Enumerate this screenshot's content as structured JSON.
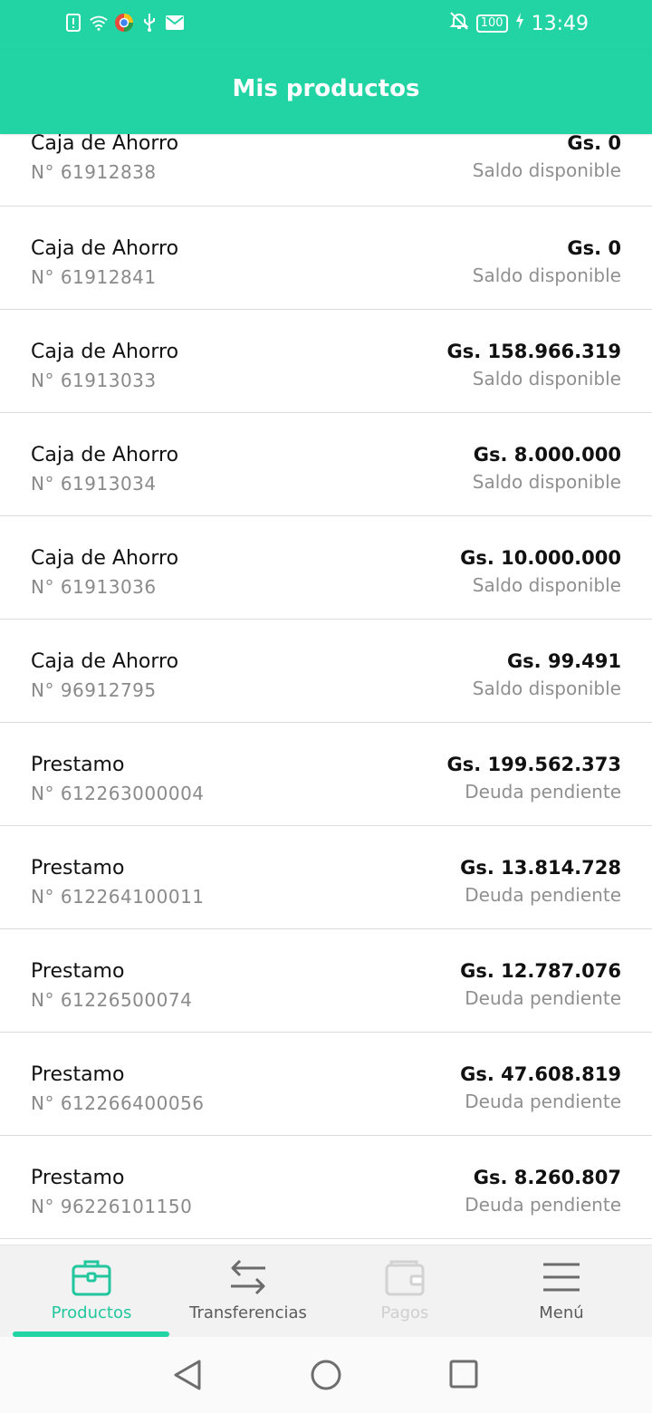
{
  "status": {
    "time": "13:49",
    "battery": "100",
    "icons": [
      "sim-alert-icon",
      "wifi-icon",
      "browser-icon",
      "usb-icon",
      "mail-icon",
      "notifications-off-icon",
      "charging-icon"
    ]
  },
  "header": {
    "title": "Mis productos"
  },
  "products": [
    {
      "name": "Caja de Ahorro",
      "number": "N° 61912838",
      "amount": "Gs. 0",
      "label": "Saldo disponible"
    },
    {
      "name": "Caja de Ahorro",
      "number": "N° 61912841",
      "amount": "Gs. 0",
      "label": "Saldo disponible"
    },
    {
      "name": "Caja de Ahorro",
      "number": "N° 61913033",
      "amount": "Gs. 158.966.319",
      "label": "Saldo disponible"
    },
    {
      "name": "Caja de Ahorro",
      "number": "N° 61913034",
      "amount": "Gs. 8.000.000",
      "label": "Saldo disponible"
    },
    {
      "name": "Caja de Ahorro",
      "number": "N° 61913036",
      "amount": "Gs. 10.000.000",
      "label": "Saldo disponible"
    },
    {
      "name": "Caja de Ahorro",
      "number": "N° 96912795",
      "amount": "Gs. 99.491",
      "label": "Saldo disponible"
    },
    {
      "name": "Prestamo",
      "number": "N° 612263000004",
      "amount": "Gs. 199.562.373",
      "label": "Deuda pendiente"
    },
    {
      "name": "Prestamo",
      "number": "N° 612264100011",
      "amount": "Gs. 13.814.728",
      "label": "Deuda pendiente"
    },
    {
      "name": "Prestamo",
      "number": "N° 61226500074",
      "amount": "Gs. 12.787.076",
      "label": "Deuda pendiente"
    },
    {
      "name": "Prestamo",
      "number": "N° 612266400056",
      "amount": "Gs. 47.608.819",
      "label": "Deuda pendiente"
    },
    {
      "name": "Prestamo",
      "number": "N° 96226101150",
      "amount": "Gs. 8.260.807",
      "label": "Deuda pendiente"
    }
  ],
  "nav": {
    "items": [
      {
        "label": "Productos",
        "icon": "briefcase-icon",
        "state": "active"
      },
      {
        "label": "Transferencias",
        "icon": "transfer-arrows-icon",
        "state": "normal"
      },
      {
        "label": "Pagos",
        "icon": "wallet-icon",
        "state": "disabled"
      },
      {
        "label": "Menú",
        "icon": "hamburger-menu-icon",
        "state": "normal"
      }
    ]
  },
  "colors": {
    "accent": "#22d3a4",
    "active_label": "#22c79d"
  }
}
